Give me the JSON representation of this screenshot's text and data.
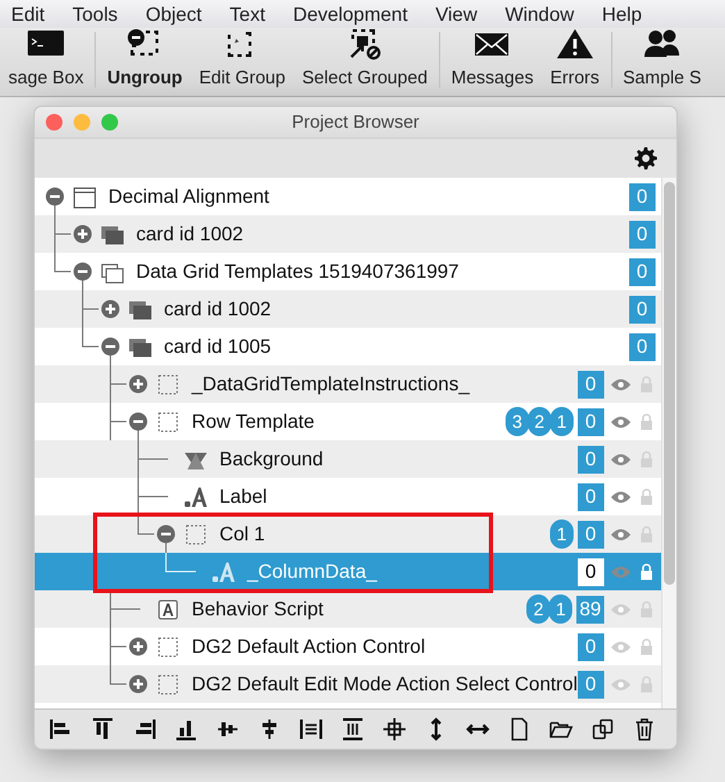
{
  "menu_bar": [
    "Edit",
    "Tools",
    "Object",
    "Text",
    "Development",
    "View",
    "Window",
    "Help"
  ],
  "toolbar": [
    {
      "label": "sage Box",
      "kind": "terminal",
      "bold": false
    },
    {
      "kind": "separator"
    },
    {
      "label": "Ungroup",
      "kind": "ungroup",
      "bold": true
    },
    {
      "label": "Edit Group",
      "kind": "edit-group",
      "bold": false
    },
    {
      "label": "Select Grouped",
      "kind": "select-grouped",
      "bold": false
    },
    {
      "kind": "separator"
    },
    {
      "label": "Messages",
      "kind": "envelope",
      "bold": false
    },
    {
      "label": "Errors",
      "kind": "warning",
      "bold": false
    },
    {
      "kind": "separator"
    },
    {
      "label": "Sample S",
      "kind": "people",
      "bold": false
    }
  ],
  "window": {
    "title": "Project Browser"
  },
  "tree": [
    {
      "label": "Decimal Alignment",
      "kind": "stack",
      "expanded": true,
      "count": "0",
      "selected": false,
      "children": [
        {
          "label": "card id 1002",
          "kind": "card",
          "expanded": false,
          "count": "0",
          "selected": false
        },
        {
          "label": "Data Grid Templates 1519407361997",
          "kind": "card-outline",
          "expanded": true,
          "count": "0",
          "selected": false,
          "children": [
            {
              "label": "card id 1002",
              "kind": "card",
              "expanded": false,
              "count": "0",
              "selected": false
            },
            {
              "label": "card id 1005",
              "kind": "card",
              "expanded": true,
              "count": "0",
              "selected": false,
              "children": [
                {
                  "label": "_DataGridTemplateInstructions_",
                  "kind": "group",
                  "expanded": false,
                  "count": "0",
                  "visible": true,
                  "locked": false,
                  "selected": false
                },
                {
                  "label": "Row Template",
                  "kind": "group",
                  "expanded": true,
                  "badges": [
                    "3",
                    "2",
                    "1"
                  ],
                  "count": "0",
                  "visible": true,
                  "locked": false,
                  "selected": false,
                  "children": [
                    {
                      "label": "Background",
                      "kind": "graphic",
                      "count": "0",
                      "visible": true,
                      "locked": false,
                      "selected": false
                    },
                    {
                      "label": "Label",
                      "kind": "field",
                      "count": "0",
                      "visible": true,
                      "locked": false,
                      "selected": false
                    },
                    {
                      "label": "Col 1",
                      "kind": "group",
                      "expanded": true,
                      "badges": [
                        "1"
                      ],
                      "count": "0",
                      "visible": true,
                      "locked": false,
                      "selected": false,
                      "highlighted": true,
                      "children": [
                        {
                          "label": "_ColumnData_",
                          "kind": "field",
                          "count": "0",
                          "visible": true,
                          "locked": false,
                          "selected": true,
                          "highlighted": true
                        }
                      ]
                    }
                  ]
                },
                {
                  "label": "Behavior Script",
                  "kind": "button",
                  "badges": [
                    "2",
                    "1"
                  ],
                  "count": "89",
                  "visible": false,
                  "locked": false,
                  "selected": false
                },
                {
                  "label": "DG2 Default Action Control",
                  "kind": "group",
                  "expanded": false,
                  "count": "0",
                  "visible": false,
                  "locked": false,
                  "selected": false
                },
                {
                  "label": "DG2 Default Edit Mode Action Select Control",
                  "kind": "group",
                  "expanded": false,
                  "count": "0",
                  "visible": false,
                  "locked": false,
                  "selected": false
                }
              ]
            }
          ]
        }
      ]
    }
  ]
}
